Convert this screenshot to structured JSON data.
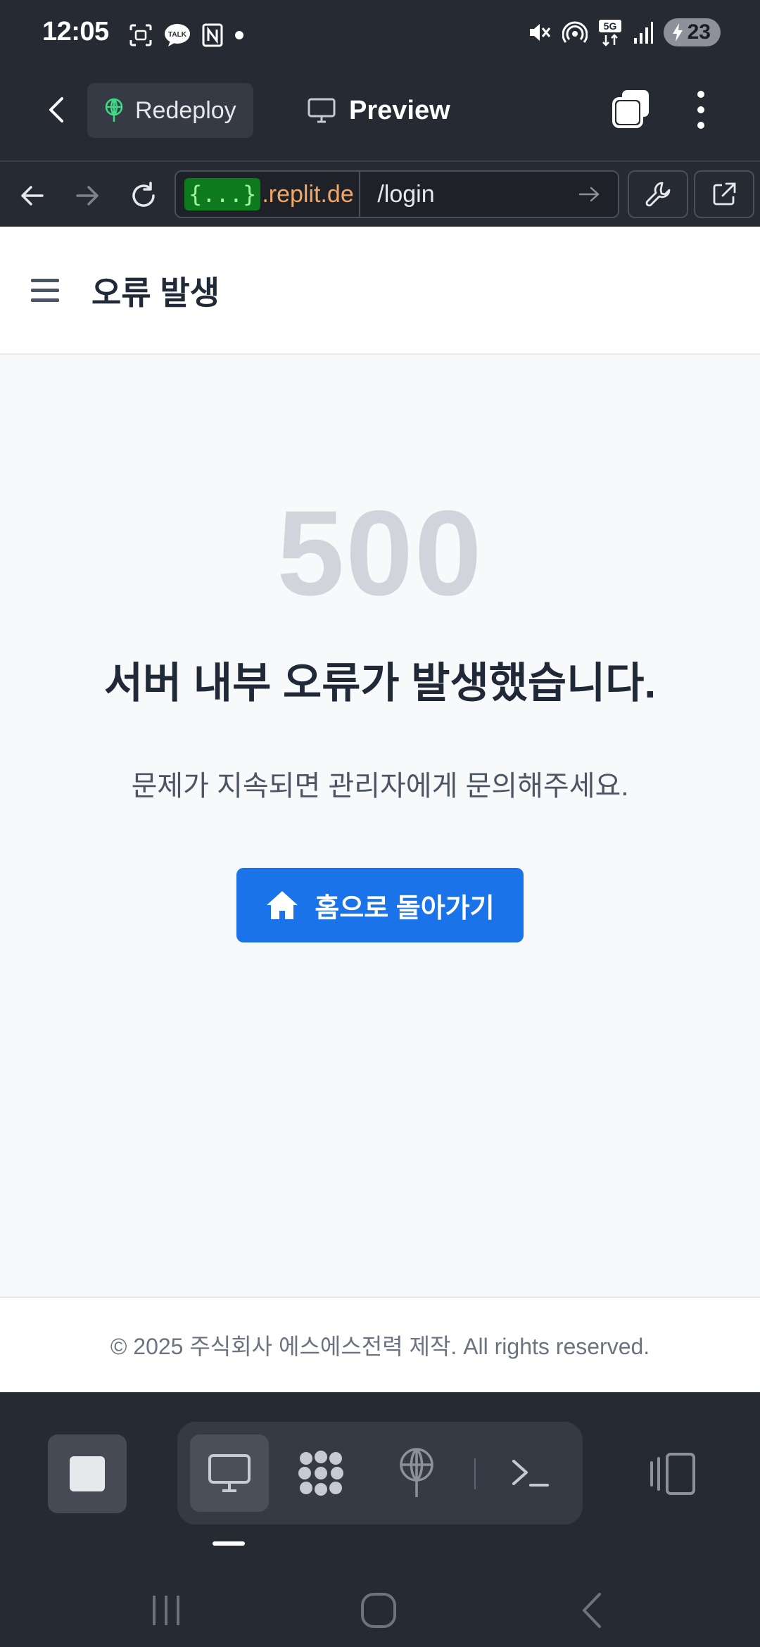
{
  "status_bar": {
    "time": "12:05",
    "left_icons": [
      "screenshot-icon",
      "talk-icon",
      "nfc-icon",
      "dot-icon"
    ],
    "right_icons": [
      "mute-icon",
      "hotspot-icon",
      "5g-icon",
      "signal-icon"
    ],
    "battery": "23"
  },
  "app_header": {
    "redeploy_label": "Redeploy",
    "preview_label": "Preview"
  },
  "url_bar": {
    "badge": "{...}",
    "domain": ".replit.de",
    "path": "/login"
  },
  "page": {
    "title": "오류 발생",
    "error_code": "500",
    "error_title": "서버 내부 오류가 발생했습니다.",
    "error_message": "문제가 지속되면 관리자에게 문의해주세요.",
    "home_button_label": "홈으로 돌아가기",
    "footer": "© 2025 주식회사 에스에스전력 제작. All rights reserved."
  },
  "colors": {
    "chrome_bg": "#262a33",
    "accent_blue": "#1a73e8",
    "error_code_gray": "#d1d5db",
    "url_badge_green": "#0d7a1e",
    "url_domain_orange": "#f2a766"
  },
  "bottom_toolbar": {
    "items": [
      "stop-icon",
      "preview-icon",
      "workspace-icon",
      "deploy-icon",
      "shell-icon",
      "panel-icon"
    ],
    "active": "preview-icon"
  }
}
